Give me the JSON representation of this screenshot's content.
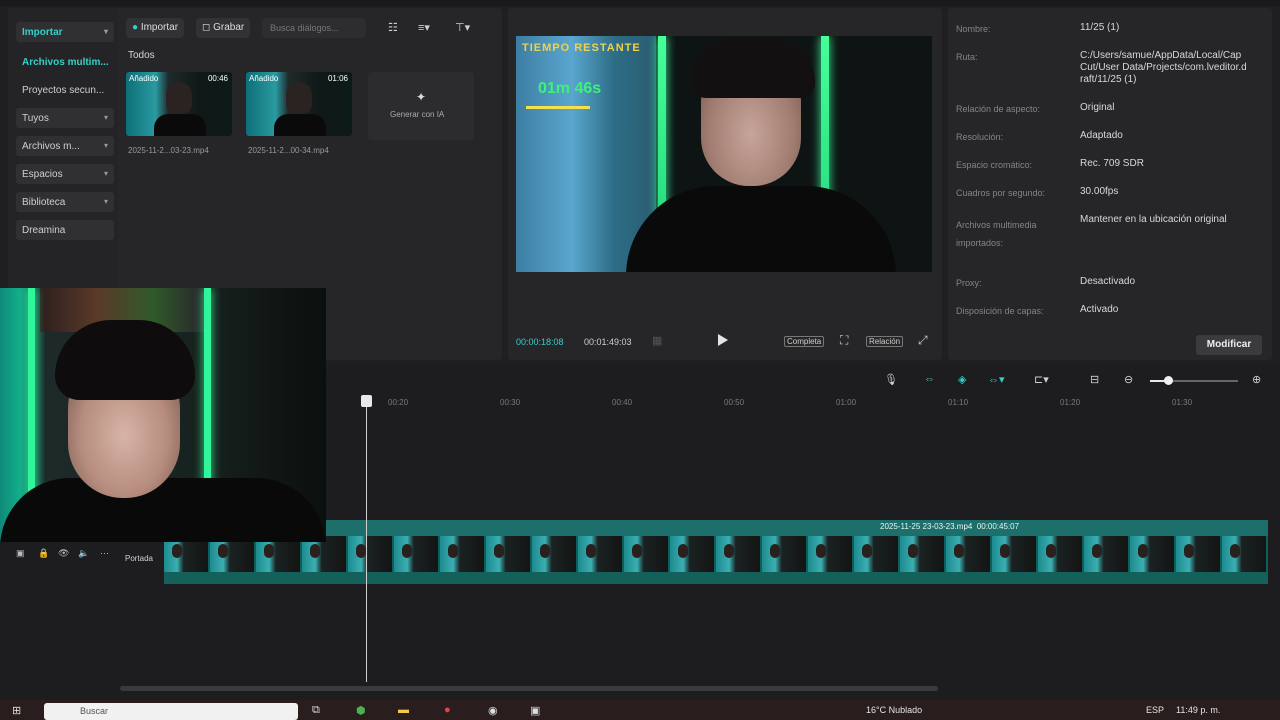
{
  "media": {
    "sidebar": {
      "import_label": "Importar",
      "items": [
        {
          "label": "Archivos multim..."
        },
        {
          "label": "Proyectos secun..."
        },
        {
          "label": "Tuyos"
        },
        {
          "label": "Archivos m..."
        },
        {
          "label": "Espacios"
        },
        {
          "label": "Biblioteca"
        },
        {
          "label": "Dreamina"
        }
      ]
    },
    "toolbar": {
      "import_button": "Importar",
      "record_button": "Grabar",
      "search_placeholder": "Busca diálogos..."
    },
    "section_label": "Todos",
    "clips": [
      {
        "tag": "Añadido",
        "duration": "00:46",
        "filename": "2025-11-2...03-23.mp4"
      },
      {
        "tag": "Añadido",
        "duration": "01:06",
        "filename": "2025-11-2...00-34.mp4"
      }
    ],
    "generate_ai_label": "Generar con IA"
  },
  "player": {
    "overlay_title": "TIEMPO RESTANTE",
    "overlay_timer": "01m 46s",
    "current_time": "00:00:18:08",
    "total_time": "00:01:49:03",
    "complete_label": "Completa",
    "ratio_label": "Relación"
  },
  "details": {
    "rows": [
      {
        "label": "Nombre:",
        "value": "11/25 (1)"
      },
      {
        "label": "Ruta:",
        "value": "C:/Users/samue/AppData/Local/CapCut/User Data/Projects/com.lveditor.draft/11/25 (1)"
      },
      {
        "label": "Relación de aspecto:",
        "value": "Original"
      },
      {
        "label": "Resolución:",
        "value": "Adaptado"
      },
      {
        "label": "Espacio cromático:",
        "value": "Rec. 709 SDR"
      },
      {
        "label": "Cuadros por segundo:",
        "value": "30.00fps"
      },
      {
        "label": "Archivos multimedia importados:",
        "value": "Mantener en la ubicación original"
      },
      {
        "label": "Proxy:",
        "value": "Desactivado"
      },
      {
        "label": "Disposición de capas:",
        "value": "Activado"
      }
    ],
    "modify_button": "Modificar"
  },
  "timeline": {
    "ruler": [
      "00:20",
      "00:30",
      "00:40",
      "00:50",
      "01:00",
      "01:10",
      "01:20",
      "01:30"
    ],
    "clip_name": "2025-11-25 23-03-23.mp4",
    "clip_duration": "00:00:45:07",
    "cover_label": "Portada"
  },
  "taskbar": {
    "search_placeholder": "Buscar",
    "weather": "16°C  Nublado",
    "lang": "ESP",
    "time": "11:49 p. m."
  },
  "colors": {
    "accent": "#35d0c8",
    "led": "#31f59a"
  }
}
